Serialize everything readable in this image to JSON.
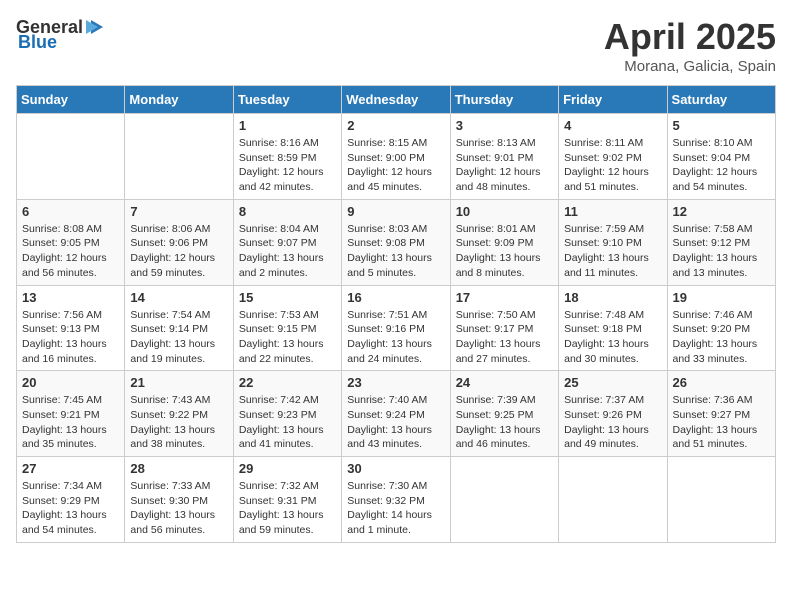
{
  "header": {
    "logo_general": "General",
    "logo_blue": "Blue",
    "month": "April 2025",
    "location": "Morana, Galicia, Spain"
  },
  "weekdays": [
    "Sunday",
    "Monday",
    "Tuesday",
    "Wednesday",
    "Thursday",
    "Friday",
    "Saturday"
  ],
  "weeks": [
    [
      null,
      null,
      {
        "day": 1,
        "sunrise": "8:16 AM",
        "sunset": "8:59 PM",
        "daylight": "12 hours and 42 minutes."
      },
      {
        "day": 2,
        "sunrise": "8:15 AM",
        "sunset": "9:00 PM",
        "daylight": "12 hours and 45 minutes."
      },
      {
        "day": 3,
        "sunrise": "8:13 AM",
        "sunset": "9:01 PM",
        "daylight": "12 hours and 48 minutes."
      },
      {
        "day": 4,
        "sunrise": "8:11 AM",
        "sunset": "9:02 PM",
        "daylight": "12 hours and 51 minutes."
      },
      {
        "day": 5,
        "sunrise": "8:10 AM",
        "sunset": "9:04 PM",
        "daylight": "12 hours and 54 minutes."
      }
    ],
    [
      {
        "day": 6,
        "sunrise": "8:08 AM",
        "sunset": "9:05 PM",
        "daylight": "12 hours and 56 minutes."
      },
      {
        "day": 7,
        "sunrise": "8:06 AM",
        "sunset": "9:06 PM",
        "daylight": "12 hours and 59 minutes."
      },
      {
        "day": 8,
        "sunrise": "8:04 AM",
        "sunset": "9:07 PM",
        "daylight": "13 hours and 2 minutes."
      },
      {
        "day": 9,
        "sunrise": "8:03 AM",
        "sunset": "9:08 PM",
        "daylight": "13 hours and 5 minutes."
      },
      {
        "day": 10,
        "sunrise": "8:01 AM",
        "sunset": "9:09 PM",
        "daylight": "13 hours and 8 minutes."
      },
      {
        "day": 11,
        "sunrise": "7:59 AM",
        "sunset": "9:10 PM",
        "daylight": "13 hours and 11 minutes."
      },
      {
        "day": 12,
        "sunrise": "7:58 AM",
        "sunset": "9:12 PM",
        "daylight": "13 hours and 13 minutes."
      }
    ],
    [
      {
        "day": 13,
        "sunrise": "7:56 AM",
        "sunset": "9:13 PM",
        "daylight": "13 hours and 16 minutes."
      },
      {
        "day": 14,
        "sunrise": "7:54 AM",
        "sunset": "9:14 PM",
        "daylight": "13 hours and 19 minutes."
      },
      {
        "day": 15,
        "sunrise": "7:53 AM",
        "sunset": "9:15 PM",
        "daylight": "13 hours and 22 minutes."
      },
      {
        "day": 16,
        "sunrise": "7:51 AM",
        "sunset": "9:16 PM",
        "daylight": "13 hours and 24 minutes."
      },
      {
        "day": 17,
        "sunrise": "7:50 AM",
        "sunset": "9:17 PM",
        "daylight": "13 hours and 27 minutes."
      },
      {
        "day": 18,
        "sunrise": "7:48 AM",
        "sunset": "9:18 PM",
        "daylight": "13 hours and 30 minutes."
      },
      {
        "day": 19,
        "sunrise": "7:46 AM",
        "sunset": "9:20 PM",
        "daylight": "13 hours and 33 minutes."
      }
    ],
    [
      {
        "day": 20,
        "sunrise": "7:45 AM",
        "sunset": "9:21 PM",
        "daylight": "13 hours and 35 minutes."
      },
      {
        "day": 21,
        "sunrise": "7:43 AM",
        "sunset": "9:22 PM",
        "daylight": "13 hours and 38 minutes."
      },
      {
        "day": 22,
        "sunrise": "7:42 AM",
        "sunset": "9:23 PM",
        "daylight": "13 hours and 41 minutes."
      },
      {
        "day": 23,
        "sunrise": "7:40 AM",
        "sunset": "9:24 PM",
        "daylight": "13 hours and 43 minutes."
      },
      {
        "day": 24,
        "sunrise": "7:39 AM",
        "sunset": "9:25 PM",
        "daylight": "13 hours and 46 minutes."
      },
      {
        "day": 25,
        "sunrise": "7:37 AM",
        "sunset": "9:26 PM",
        "daylight": "13 hours and 49 minutes."
      },
      {
        "day": 26,
        "sunrise": "7:36 AM",
        "sunset": "9:27 PM",
        "daylight": "13 hours and 51 minutes."
      }
    ],
    [
      {
        "day": 27,
        "sunrise": "7:34 AM",
        "sunset": "9:29 PM",
        "daylight": "13 hours and 54 minutes."
      },
      {
        "day": 28,
        "sunrise": "7:33 AM",
        "sunset": "9:30 PM",
        "daylight": "13 hours and 56 minutes."
      },
      {
        "day": 29,
        "sunrise": "7:32 AM",
        "sunset": "9:31 PM",
        "daylight": "13 hours and 59 minutes."
      },
      {
        "day": 30,
        "sunrise": "7:30 AM",
        "sunset": "9:32 PM",
        "daylight": "14 hours and 1 minute."
      },
      null,
      null,
      null
    ]
  ],
  "labels": {
    "sunrise": "Sunrise: ",
    "sunset": "Sunset: ",
    "daylight": "Daylight: "
  }
}
